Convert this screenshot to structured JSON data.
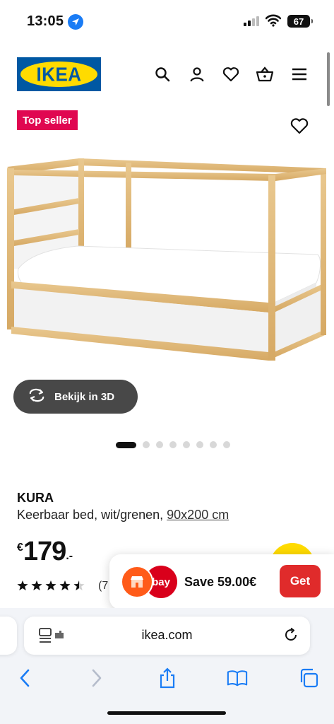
{
  "status_bar": {
    "time": "13:05",
    "battery": "67"
  },
  "header": {
    "logo_text": "IKEA"
  },
  "product": {
    "badge": "Top seller",
    "view_3d_label": "Bekijk in 3D",
    "name": "KURA",
    "description": "Keerbaar bed, wit/grenen,",
    "size": "90x200 cm",
    "price_currency": "€",
    "price_value": "179",
    "price_decimal": ".-",
    "rating_value": 4.5,
    "rating_count": "(7"
  },
  "carousel": {
    "total_images": 8,
    "active_index": 0
  },
  "popup": {
    "coin_label": "bay",
    "save_text": "Save 59.00€",
    "get_label": "Get"
  },
  "browser": {
    "url": "ikea.com"
  },
  "colors": {
    "ikea_blue": "#0058a3",
    "ikea_yellow": "#ffdb00",
    "badge_red": "#e00751",
    "get_button": "#e02b2b",
    "ios_blue": "#1a7cf5"
  }
}
